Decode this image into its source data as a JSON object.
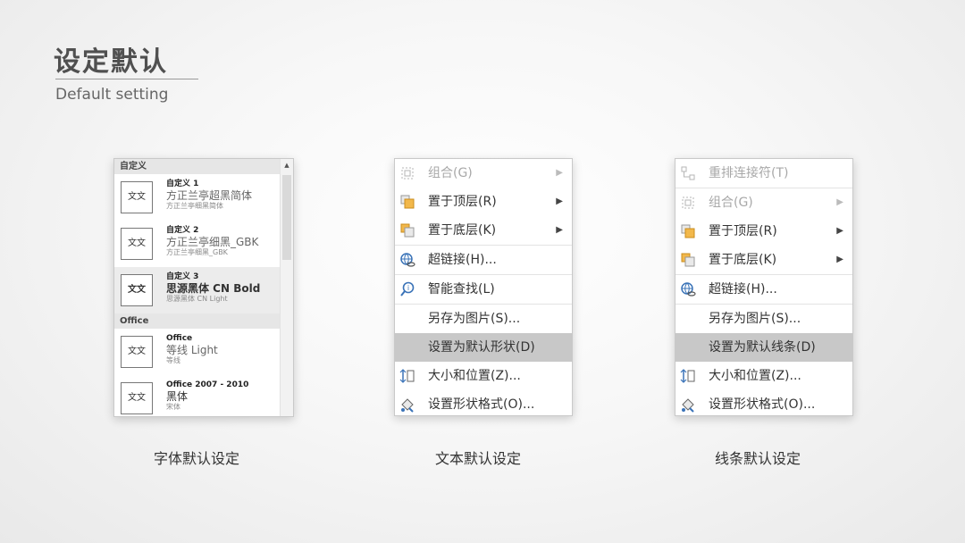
{
  "slide": {
    "title": "设定默认",
    "subtitle": "Default setting"
  },
  "font_panel": {
    "section_custom": "自定义",
    "section_office": "Office",
    "scroll_up": "▲",
    "items": [
      {
        "name": "自定义 1",
        "major": "方正兰亭超黑简体",
        "minor": "方正兰亭细黑简体",
        "thumb": "文文"
      },
      {
        "name": "自定义 2",
        "major": "方正兰亭细黑_GBK",
        "minor": "方正兰亭细黑_GBK",
        "thumb": "文文"
      },
      {
        "name": "自定义 3",
        "major": "思源黑体 CN Bold",
        "minor": "思源黑体 CN Light",
        "thumb": "文文"
      },
      {
        "name": "Office",
        "major": "等线 Light",
        "minor": "等线",
        "thumb": "文文"
      },
      {
        "name": "Office 2007 - 2010",
        "major": "黑体",
        "minor": "宋体",
        "thumb": "文文"
      }
    ]
  },
  "text_menu": {
    "items": [
      {
        "label": "组合(G)",
        "icon": "group-icon",
        "disabled": true,
        "submenu": true
      },
      {
        "label": "置于顶层(R)",
        "icon": "bring-to-front-icon",
        "submenu": true
      },
      {
        "label": "置于底层(K)",
        "icon": "send-to-back-icon",
        "submenu": true,
        "sep": true
      },
      {
        "label": "超链接(H)...",
        "icon": "hyperlink-icon",
        "sep": true
      },
      {
        "label": "智能查找(L)",
        "icon": "smart-lookup-icon",
        "sep": true
      },
      {
        "label": "另存为图片(S)...",
        "icon": "none"
      },
      {
        "label": "设置为默认形状(D)",
        "icon": "none",
        "highlighted": true
      },
      {
        "label": "大小和位置(Z)...",
        "icon": "size-position-icon"
      },
      {
        "label": "设置形状格式(O)...",
        "icon": "format-shape-icon"
      }
    ]
  },
  "line_menu": {
    "items": [
      {
        "label": "重排连接符(T)",
        "icon": "reroute-connectors-icon",
        "disabled": true,
        "sep": true
      },
      {
        "label": "组合(G)",
        "icon": "group-icon",
        "disabled": true,
        "submenu": true
      },
      {
        "label": "置于顶层(R)",
        "icon": "bring-to-front-icon",
        "submenu": true
      },
      {
        "label": "置于底层(K)",
        "icon": "send-to-back-icon",
        "submenu": true,
        "sep": true
      },
      {
        "label": "超链接(H)...",
        "icon": "hyperlink-icon",
        "sep": true
      },
      {
        "label": "另存为图片(S)...",
        "icon": "none"
      },
      {
        "label": "设置为默认线条(D)",
        "icon": "none",
        "highlighted": true
      },
      {
        "label": "大小和位置(Z)...",
        "icon": "size-position-icon"
      },
      {
        "label": "设置形状格式(O)...",
        "icon": "format-shape-icon"
      }
    ]
  },
  "captions": {
    "font": "字体默认设定",
    "text": "文本默认设定",
    "line": "线条默认设定"
  },
  "colors": {
    "highlight": "#c8c8c8",
    "accent": "#f2b84b",
    "link_icon": "#3a73b8"
  }
}
